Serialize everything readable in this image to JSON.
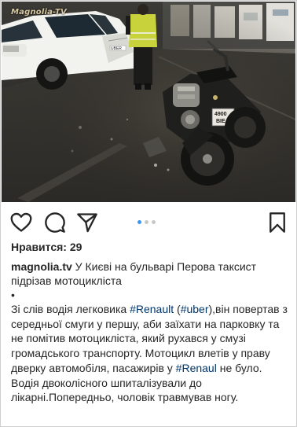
{
  "photo": {
    "watermark": "Magnolia-TV",
    "car_door_text": "UBER",
    "plate_text": "4900\nBIE"
  },
  "actions": {
    "like_icon": "heart-outline-icon",
    "comment_icon": "speech-bubble-icon",
    "share_icon": "paper-plane-icon",
    "save_icon": "bookmark-outline-icon",
    "carousel_dots": 3,
    "carousel_active": 1,
    "accent": "#3897f0"
  },
  "post": {
    "likes_label": "Нравится: 29",
    "username": "magnolia.tv",
    "caption_text": " У Києві на бульварі Перова таксист підрізав мотоцикліста",
    "bullet": "•",
    "body": {
      "seg1": "Зі слів водія легковика ",
      "tag1": "#Renault",
      "seg2": " (",
      "tag2": "#uber",
      "seg3": "),він повертав з середньої смуги у першу, аби заїхати на парковку та не помітив мотоцикліста, який рухався у смузі громадського транспорту. Мотоцикл влетів у праву дверку автомобіля, пасажирів у ",
      "tag3": "#Renaul",
      "seg4": " не було. Водія двоколісного шпиталізували до лікарні.Попередньо, чоловік травмував ногу."
    },
    "hashtag_color": "#003569"
  }
}
